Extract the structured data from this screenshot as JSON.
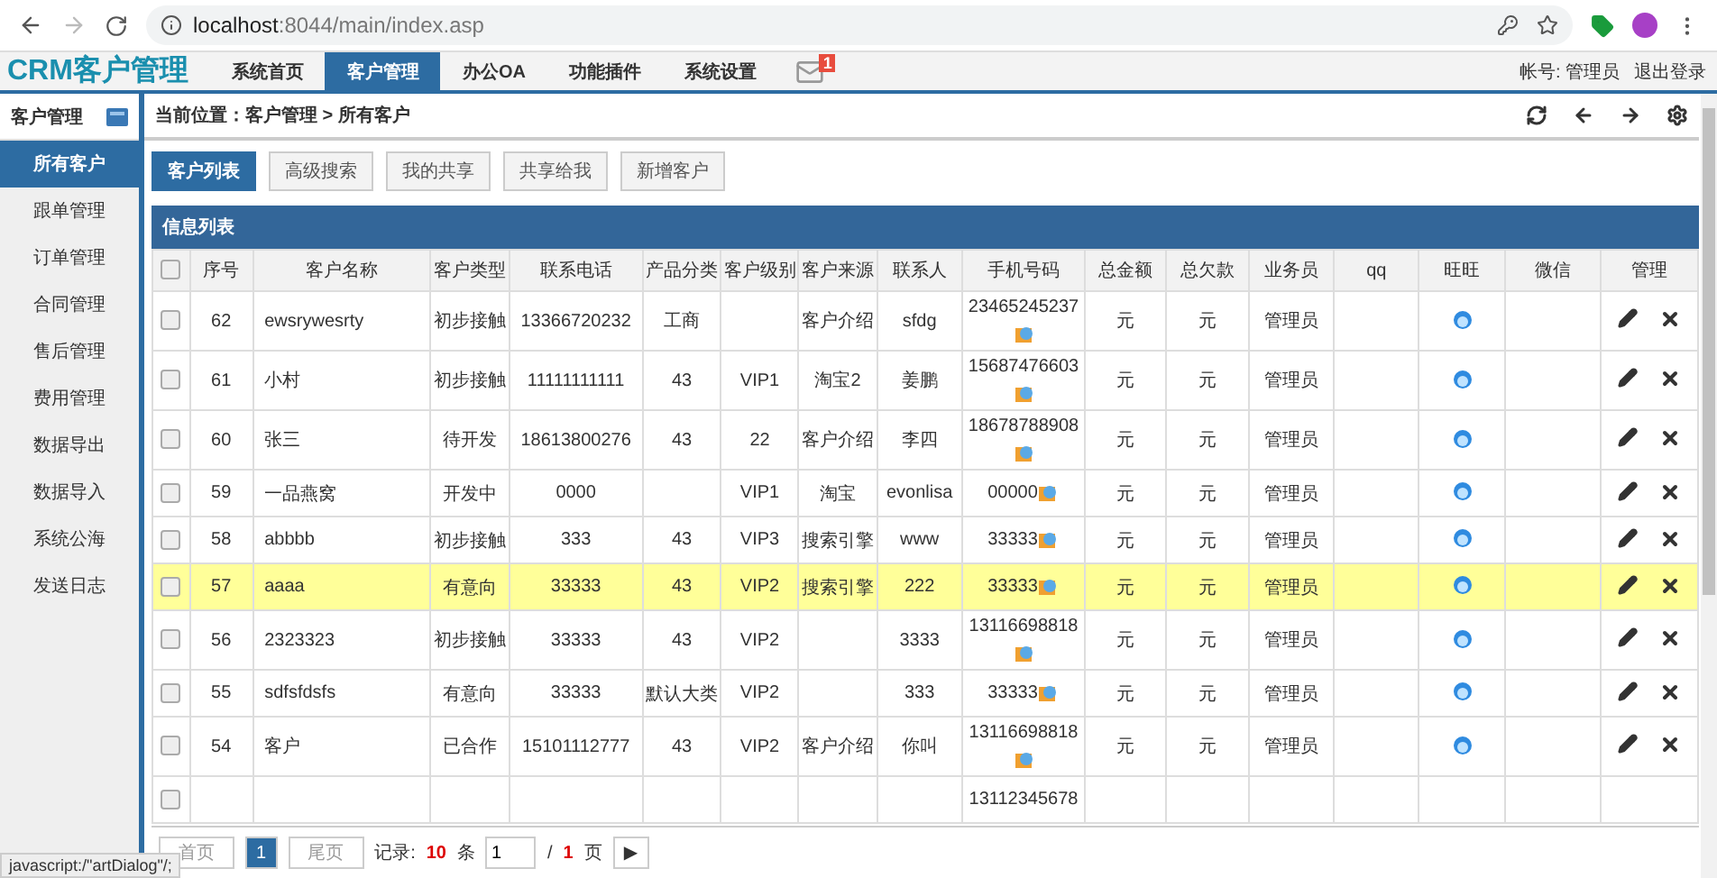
{
  "browser": {
    "url_host": "localhost",
    "url_path": ":8044/main/index.asp"
  },
  "app": {
    "logo": "CRM客户管理",
    "nav": [
      {
        "label": "系统首页",
        "selected": false
      },
      {
        "label": "客户管理",
        "selected": true
      },
      {
        "label": "办公OA",
        "selected": false
      },
      {
        "label": "功能插件",
        "selected": false
      },
      {
        "label": "系统设置",
        "selected": false
      }
    ],
    "mail_badge": "1",
    "account": "帐号: 管理员",
    "logout": "退出登录"
  },
  "sidebar": {
    "title": "客户管理",
    "items": [
      {
        "label": "所有客户",
        "selected": true
      },
      {
        "label": "跟单管理",
        "selected": false
      },
      {
        "label": "订单管理",
        "selected": false
      },
      {
        "label": "合同管理",
        "selected": false
      },
      {
        "label": "售后管理",
        "selected": false
      },
      {
        "label": "费用管理",
        "selected": false
      },
      {
        "label": "数据导出",
        "selected": false
      },
      {
        "label": "数据导入",
        "selected": false
      },
      {
        "label": "系统公海",
        "selected": false
      },
      {
        "label": "发送日志",
        "selected": false
      }
    ]
  },
  "breadcrumb": "当前位置：客户管理 > 所有客户",
  "actions": [
    {
      "label": "客户列表",
      "selected": true
    },
    {
      "label": "高级搜索",
      "selected": false
    },
    {
      "label": "我的共享",
      "selected": false
    },
    {
      "label": "共享给我",
      "selected": false
    },
    {
      "label": "新增客户",
      "selected": false
    }
  ],
  "table": {
    "title": "信息列表",
    "select_all": false,
    "columns": [
      "序号",
      "客户名称",
      "客户类型",
      "联系电话",
      "产品分类",
      "客户级别",
      "客户来源",
      "联系人",
      "手机号码",
      "总金额",
      "总欠款",
      "业务员",
      "qq",
      "旺旺",
      "微信",
      "管理"
    ],
    "rows": [
      {
        "checked": false,
        "highlighted": false,
        "id": "62",
        "name": "ewsrywesrty",
        "type": "初步接触",
        "phone": "13366720232",
        "product": "工商",
        "level": "",
        "source": "客户介绍",
        "contact": "sfdg",
        "mobile": "23465245237",
        "total": "元",
        "owed": "元",
        "staff": "管理员"
      },
      {
        "checked": false,
        "highlighted": false,
        "id": "61",
        "name": "小村",
        "type": "初步接触",
        "phone": "11111111111",
        "product": "43",
        "level": "VIP1",
        "source": "淘宝2",
        "contact": "姜鹏",
        "mobile": "15687476603",
        "total": "元",
        "owed": "元",
        "staff": "管理员"
      },
      {
        "checked": false,
        "highlighted": false,
        "id": "60",
        "name": "张三",
        "type": "待开发",
        "phone": "18613800276",
        "product": "43",
        "level": "22",
        "source": "客户介绍",
        "contact": "李四",
        "mobile": "18678788908",
        "total": "元",
        "owed": "元",
        "staff": "管理员"
      },
      {
        "checked": false,
        "highlighted": false,
        "id": "59",
        "name": "一品燕窝",
        "type": "开发中",
        "phone": "0000",
        "product": "",
        "level": "VIP1",
        "source": "淘宝",
        "contact": "evonlisa",
        "mobile": "00000",
        "total": "元",
        "owed": "元",
        "staff": "管理员"
      },
      {
        "checked": false,
        "highlighted": false,
        "id": "58",
        "name": "abbbb",
        "type": "初步接触",
        "phone": "333",
        "product": "43",
        "level": "VIP3",
        "source": "搜索引擎",
        "contact": "www",
        "mobile": "33333",
        "total": "元",
        "owed": "元",
        "staff": "管理员"
      },
      {
        "checked": false,
        "highlighted": true,
        "id": "57",
        "name": "aaaa",
        "type": "有意向",
        "phone": "33333",
        "product": "43",
        "level": "VIP2",
        "source": "搜索引擎",
        "contact": "222",
        "mobile": "33333",
        "total": "元",
        "owed": "元",
        "staff": "管理员"
      },
      {
        "checked": false,
        "highlighted": false,
        "id": "56",
        "name": "2323323",
        "type": "初步接触",
        "phone": "33333",
        "product": "43",
        "level": "VIP2",
        "source": "",
        "contact": "3333",
        "mobile": "13116698818",
        "total": "元",
        "owed": "元",
        "staff": "管理员"
      },
      {
        "checked": false,
        "highlighted": false,
        "id": "55",
        "name": "sdfsfdsfs",
        "type": "有意向",
        "phone": "33333",
        "product": "默认大类",
        "level": "VIP2",
        "source": "",
        "contact": "333",
        "mobile": "33333",
        "total": "元",
        "owed": "元",
        "staff": "管理员"
      },
      {
        "checked": false,
        "highlighted": false,
        "id": "54",
        "name": "客户",
        "type": "已合作",
        "phone": "15101112777",
        "product": "43",
        "level": "VIP2",
        "source": "客户介绍",
        "contact": "你叫",
        "mobile": "13116698818",
        "total": "元",
        "owed": "元",
        "staff": "管理员"
      },
      {
        "checked": false,
        "highlighted": false,
        "mobile": "13112345678"
      }
    ]
  },
  "pager": {
    "first": "首页",
    "pages": [
      {
        "label": "1",
        "selected": true
      }
    ],
    "last": "尾页",
    "records_label": "记录:",
    "records": "10",
    "records_unit": "条",
    "page_value": "1",
    "page_total_prefix": "/",
    "page_total": "1",
    "page_unit": "页",
    "go": "▶"
  },
  "status": "javascript:/\"artDialog\"/;"
}
